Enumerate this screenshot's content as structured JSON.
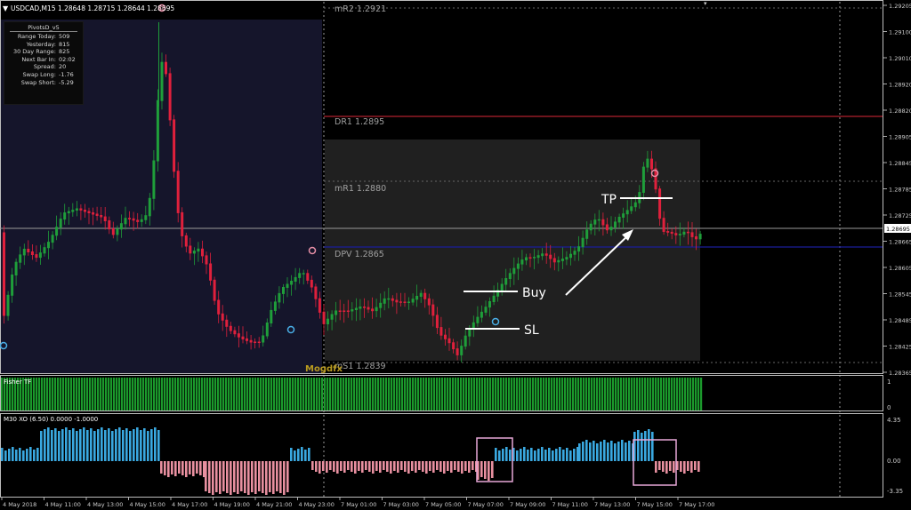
{
  "header": {
    "symbol_line": "USDCAD,M15  1.28648 1.28715 1.28644 1.28695",
    "badge": "0"
  },
  "info_panel": {
    "title": "PivotsD_v5",
    "rows": [
      {
        "k": "Range Today:",
        "v": "509"
      },
      {
        "k": "Yesterday:",
        "v": "815"
      },
      {
        "k": "30 Day Range:",
        "v": "825"
      },
      {
        "k": "Next Bar In:",
        "v": "02:02"
      },
      {
        "k": "Spread:",
        "v": "20"
      },
      {
        "k": "Swap Long:",
        "v": "-1.76"
      },
      {
        "k": "Swap Short:",
        "v": "-5.29"
      }
    ]
  },
  "levels": {
    "mR2": "mR2  1.2921",
    "DR1": "DR1  1.2895",
    "mR1": "mR1  1.2880",
    "DPV": "DPV  1.2865",
    "mS1": "mS1  1.2839"
  },
  "annotations": {
    "tp": "TP",
    "buy": "Buy",
    "sl": "SL"
  },
  "watermark": "Mogdfx",
  "price_axis": {
    "ticks": [
      "1.29205",
      "1.29100",
      "1.29010",
      "1.28920",
      "1.28820",
      "1.28905",
      "1.28845",
      "1.28785",
      "1.28725",
      "1.28665",
      "1.28605",
      "1.28545",
      "1.28485",
      "1.28425",
      "1.28365"
    ],
    "current": "1.28695"
  },
  "indicator1": {
    "label": "Fisher TF",
    "axis": [
      "1",
      "0"
    ]
  },
  "indicator2": {
    "label": "M30 XO (6.50) 0.0000 -1.0000",
    "axis": [
      "4.35",
      "0.00",
      "-3.35"
    ]
  },
  "time_axis": [
    "4 May 2018",
    "4 May 11:00",
    "4 May 13:00",
    "4 May 15:00",
    "4 May 17:00",
    "4 May 19:00",
    "4 May 21:00",
    "4 May 23:00",
    "7 May 01:00",
    "7 May 03:00",
    "7 May 05:00",
    "7 May 07:00",
    "7 May 09:00",
    "7 May 11:00",
    "7 May 13:00",
    "7 May 15:00",
    "7 May 17:00"
  ],
  "colors": {
    "bull": "#1f9e3a",
    "bear": "#e0203c",
    "left_bg": "#15152b",
    "box_bg": "#202020",
    "dr1_line": "#b0202c",
    "dpv_line": "#1b1e9a",
    "hist_up": "#3aa8e0",
    "hist_down": "#e890a0",
    "fisher": "#1b9a2c",
    "box_outline": "#e8a8d8"
  }
}
